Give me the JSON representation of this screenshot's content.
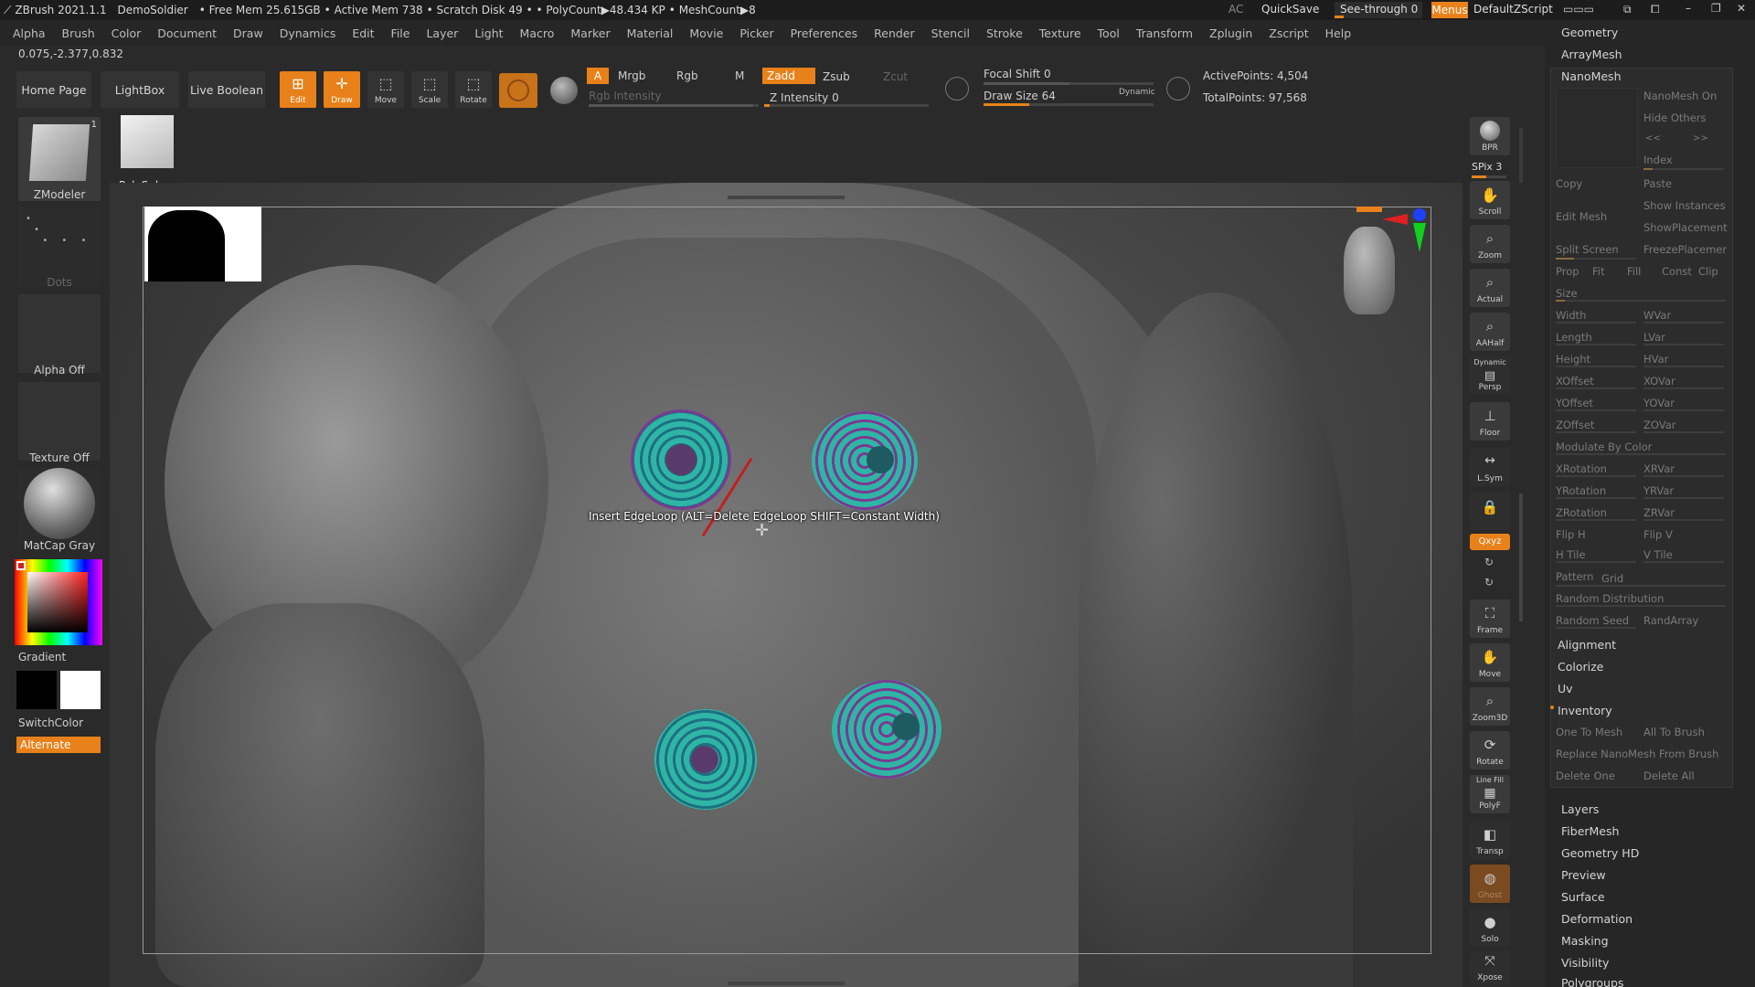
{
  "titlebar": {
    "app": "ZBrush 2021.1.1",
    "doc": "DemoSoldier",
    "free_mem": "• Free Mem 25.615GB",
    "active_mem": "• Active Mem 738",
    "scratch": "• Scratch Disk 49",
    "polycount": "• • PolyCount▶48.434 KP",
    "meshcount": "• MeshCount▶8",
    "ac": "AC",
    "quicksave": "QuickSave",
    "see_through": "See-through  0",
    "menus": "Menus",
    "script": "DefaultZScript"
  },
  "menubar": [
    "Alpha",
    "Brush",
    "Color",
    "Document",
    "Draw",
    "Dynamics",
    "Edit",
    "File",
    "Layer",
    "Light",
    "Macro",
    "Marker",
    "Material",
    "Movie",
    "Picker",
    "Preferences",
    "Render",
    "Stencil",
    "Stroke",
    "Texture",
    "Tool",
    "Transform",
    "Zplugin",
    "Zscript",
    "Help"
  ],
  "coords": "0.075,-2.377,0.832",
  "toolbar": {
    "home": "Home Page",
    "lightbox": "LightBox",
    "live_boolean": "Live Boolean",
    "edit": "Edit",
    "draw": "Draw",
    "move": "Move",
    "scale": "Scale",
    "rotate": "Rotate",
    "a": "A",
    "mrgb": "Mrgb",
    "rgb": "Rgb",
    "m": "M",
    "zadd": "Zadd",
    "zsub": "Zsub",
    "zcut": "Zcut",
    "rgb_intensity": "Rgb Intensity",
    "z_intensity": "Z Intensity 0",
    "focal_shift": "Focal Shift 0",
    "draw_size": "Draw Size 64",
    "dynamic": "Dynamic",
    "active_points": "ActivePoints: 4,504",
    "total_points": "TotalPoints: 97,568"
  },
  "left": {
    "zmodeler": "ZModeler",
    "zmodeler_count": "1",
    "polysphere": "PolySphere",
    "dots": "Dots",
    "alpha_off": "Alpha Off",
    "texture_off": "Texture Off",
    "matcap": "MatCap Gray",
    "gradient": "Gradient",
    "switchcolor": "SwitchColor",
    "alternate": "Alternate"
  },
  "viewport": {
    "tooltip": "Insert EdgeLoop (ALT=Delete EdgeLoop SHIFT=Constant Width)"
  },
  "shelf": {
    "bpr": "BPR",
    "spix": "SPix 3",
    "scroll": "Scroll",
    "zoom": "Zoom",
    "actual": "Actual",
    "aahalf": "AAHalf",
    "dynamic": "Dynamic",
    "persp": "Persp",
    "floor": "Floor",
    "lsym": "L.Sym",
    "xyz": "Qxyz",
    "frame": "Frame",
    "move": "Move",
    "zoom3d": "Zoom3D",
    "rotate": "Rotate",
    "linefill": "Line Fill",
    "polyf": "PolyF",
    "transp": "Transp",
    "ghost": "Ghost",
    "solo": "Solo",
    "xpose": "Xpose"
  },
  "right": {
    "geometry": "Geometry",
    "arraymesh": "ArrayMesh",
    "nanomesh": "NanoMesh",
    "nanomesh_on": "NanoMesh On",
    "hide_others": "Hide Others",
    "prev": "<<",
    "next": ">>",
    "index": "Index",
    "copy": "Copy",
    "paste": "Paste",
    "edit_mesh": "Edit Mesh",
    "show_instances": "Show Instances",
    "show_placement": "ShowPlacement",
    "split_screen": "Split Screen",
    "freeze_placement": "FreezePlacemer",
    "prop": "Prop",
    "fit": "Fit",
    "fill": "Fill",
    "const": "Const",
    "clip": "Clip",
    "size": "Size",
    "width": "Width",
    "wvar": "WVar",
    "length": "Length",
    "lvar": "LVar",
    "height": "Height",
    "hvar": "HVar",
    "xoffset": "XOffset",
    "xovar": "XOVar",
    "yoffset": "YOffset",
    "yovar": "YOVar",
    "zoffset": "ZOffset",
    "zovar": "ZOVar",
    "modulate": "Modulate By Color",
    "xrotation": "XRotation",
    "xrvar": "XRVar",
    "yrotation": "YRotation",
    "yrvar": "YRVar",
    "zrotation": "ZRotation",
    "zrvar": "ZRVar",
    "fliph": "Flip H",
    "flipv": "Flip V",
    "htile": "H Tile",
    "vtile": "V Tile",
    "pattern": "Pattern",
    "grid": "Grid",
    "random_distribution": "Random Distribution",
    "random_seed": "Random Seed",
    "randarray": "RandArray",
    "alignment": "Alignment",
    "colorize": "Colorize",
    "uv": "Uv",
    "inventory": "Inventory",
    "one_to_mesh": "One To Mesh",
    "all_to_brush": "All To Brush",
    "replace": "Replace NanoMesh From Brush",
    "delete_one": "Delete One",
    "delete_all": "Delete All",
    "layers": "Layers",
    "fibermesh": "FiberMesh",
    "geometry_hd": "Geometry HD",
    "preview": "Preview",
    "surface": "Surface",
    "deformation": "Deformation",
    "masking": "Masking",
    "visibility": "Visibility",
    "polygroups": "Polygroups"
  }
}
